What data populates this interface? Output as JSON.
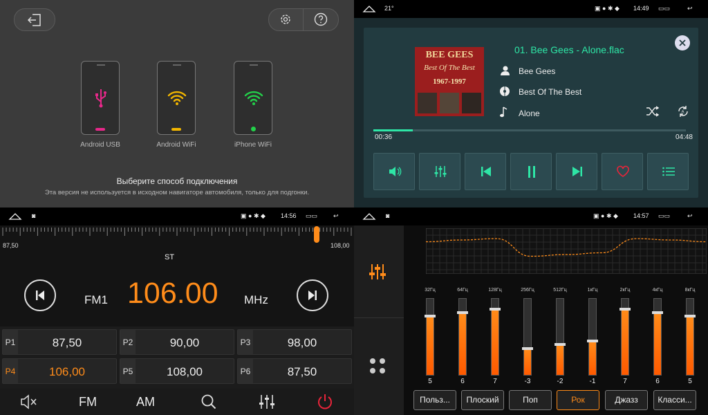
{
  "connect": {
    "options": [
      {
        "label": "Android USB"
      },
      {
        "label": "Android WiFi"
      },
      {
        "label": "iPhone WiFi"
      }
    ],
    "title": "Выберите способ подключения",
    "note": "Эта версия не используется в исходном навигаторе автомобиля, только для подгонки."
  },
  "music": {
    "status": {
      "temp": "21°",
      "time": "14:49"
    },
    "album_art": {
      "band": "BEE GEES",
      "album": "Best Of The Best",
      "years": "1967-1997"
    },
    "track": "01. Bee Gees - Alone.flac",
    "artist": "Bee Gees",
    "album": "Best Of The Best",
    "title": "Alone",
    "elapsed": "00:36",
    "duration": "04:48",
    "progress": 0.125
  },
  "radio": {
    "status": {
      "time": "14:56"
    },
    "scale_min": "87,50",
    "scale_max": "108,00",
    "stereo": "ST",
    "band": "FM1",
    "frequency": "106.00",
    "unit": "MHz",
    "presets": [
      {
        "label": "P1",
        "value": "87,50"
      },
      {
        "label": "P2",
        "value": "90,00"
      },
      {
        "label": "P3",
        "value": "98,00"
      },
      {
        "label": "P4",
        "value": "106,00"
      },
      {
        "label": "P5",
        "value": "108,00"
      },
      {
        "label": "P6",
        "value": "87,50"
      }
    ],
    "bottom": {
      "fm": "FM",
      "am": "AM"
    }
  },
  "eq": {
    "status": {
      "time": "14:57"
    },
    "bands": [
      {
        "freq": "32Гц",
        "value": "5",
        "level": 0.77
      },
      {
        "freq": "64Гц",
        "value": "6",
        "level": 0.82
      },
      {
        "freq": "128Гц",
        "value": "7",
        "level": 0.86
      },
      {
        "freq": "256Гц",
        "value": "-3",
        "level": 0.35
      },
      {
        "freq": "512Гц",
        "value": "-2",
        "level": 0.4
      },
      {
        "freq": "1кГц",
        "value": "-1",
        "level": 0.45
      },
      {
        "freq": "2кГц",
        "value": "7",
        "level": 0.86
      },
      {
        "freq": "4кГц",
        "value": "6",
        "level": 0.82
      },
      {
        "freq": "8кГц",
        "value": "5",
        "level": 0.77
      }
    ],
    "presets": [
      "Польз...",
      "Плоский",
      "Поп",
      "Рок",
      "Джазз",
      "Класси..."
    ],
    "active_preset": "Рок"
  },
  "colors": {
    "accent_orange": "#ff8c1a",
    "teal": "#2ee6a6",
    "pink": "#e8288a",
    "yellow": "#f2b600",
    "green": "#23d14a"
  }
}
